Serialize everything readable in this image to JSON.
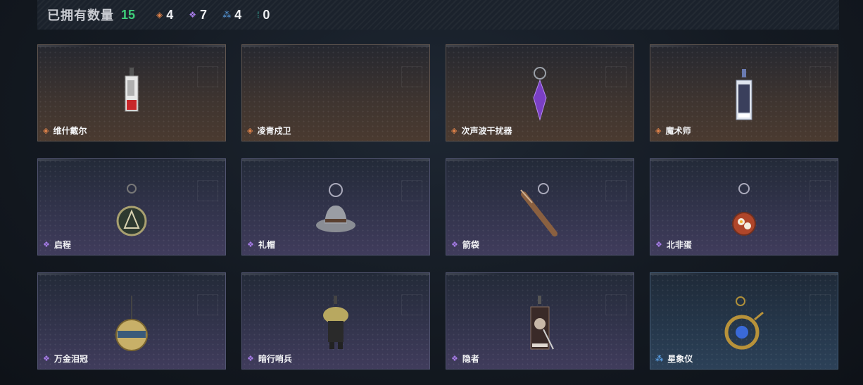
{
  "header": {
    "title": "已拥有数量",
    "total": "15",
    "rarities": [
      {
        "glyph": "◈",
        "color": "orange",
        "count": "4"
      },
      {
        "glyph": "❖",
        "color": "purple",
        "count": "7"
      },
      {
        "glyph": "⁂",
        "color": "blue",
        "count": "4"
      },
      {
        "glyph": "⁞",
        "color": "teal",
        "count": "0"
      }
    ]
  },
  "items": [
    {
      "name": "维什戴尔",
      "rarity": "orange",
      "icon": "keychain-card-icon"
    },
    {
      "name": "凌青戍卫",
      "rarity": "orange",
      "icon": "empty"
    },
    {
      "name": "次声波干扰器",
      "rarity": "orange",
      "icon": "purple-crystal-icon"
    },
    {
      "name": "魔术师",
      "rarity": "orange",
      "icon": "magician-card-icon"
    },
    {
      "name": "启程",
      "rarity": "purple",
      "icon": "medal-charm-icon"
    },
    {
      "name": "礼帽",
      "rarity": "purple",
      "icon": "hat-charm-icon"
    },
    {
      "name": "箭袋",
      "rarity": "purple",
      "icon": "quiver-charm-icon"
    },
    {
      "name": "北非蛋",
      "rarity": "purple",
      "icon": "egg-pan-charm-icon"
    },
    {
      "name": "万金泪冠",
      "rarity": "purple",
      "icon": "globe-charm-icon"
    },
    {
      "name": "暗行哨兵",
      "rarity": "purple",
      "icon": "sentinel-figure-icon"
    },
    {
      "name": "隐者",
      "rarity": "purple",
      "icon": "hermit-card-icon"
    },
    {
      "name": "星象仪",
      "rarity": "blue",
      "icon": "astrolabe-charm-icon"
    }
  ],
  "colors": {
    "orange": "#e0834a",
    "purple": "#a77ce8",
    "blue": "#5aa0e6",
    "teal": "#35c7b0",
    "total": "#3ecf7a"
  }
}
